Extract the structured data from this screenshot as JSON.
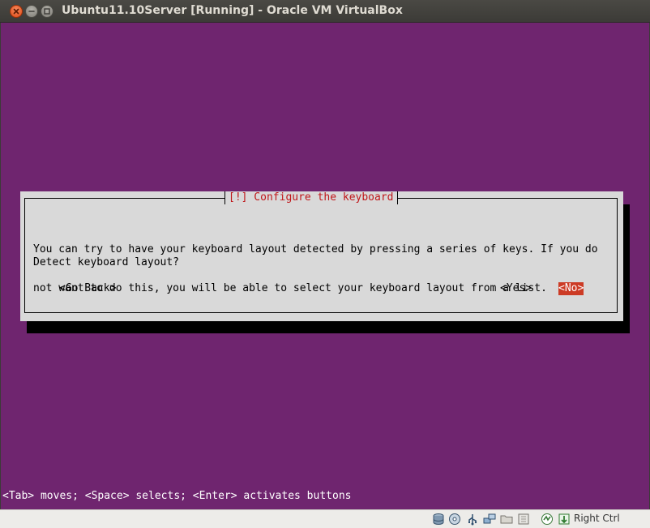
{
  "window": {
    "title": "Ubuntu11.10Server [Running] - Oracle VM VirtualBox"
  },
  "dialog": {
    "title": "[!] Configure the keyboard",
    "message_lines": [
      "You can try to have your keyboard layout detected by pressing a series of keys. If you do",
      "not want to do this, you will be able to select your keyboard layout from a list."
    ],
    "question": "Detect keyboard layout?",
    "buttons": {
      "back": "<Go Back>",
      "yes": "<Yes>",
      "no": "<No>"
    },
    "selected_button": "no"
  },
  "console": {
    "hint": "<Tab> moves; <Space> selects; <Enter> activates buttons"
  },
  "statusbar": {
    "icons": [
      "hard-disk-icon",
      "optical-drive-icon",
      "usb-icon",
      "network-icon",
      "shared-folder-icon",
      "display-icon",
      "virtualization-icon",
      "mouse-integration-icon"
    ],
    "host_key": "Right Ctrl"
  },
  "colors": {
    "console_bg": "#6f256f",
    "dialog_bg": "#d9d9d9",
    "dialog_title": "#c0171a",
    "selected_button_bg": "#cc3b25"
  }
}
